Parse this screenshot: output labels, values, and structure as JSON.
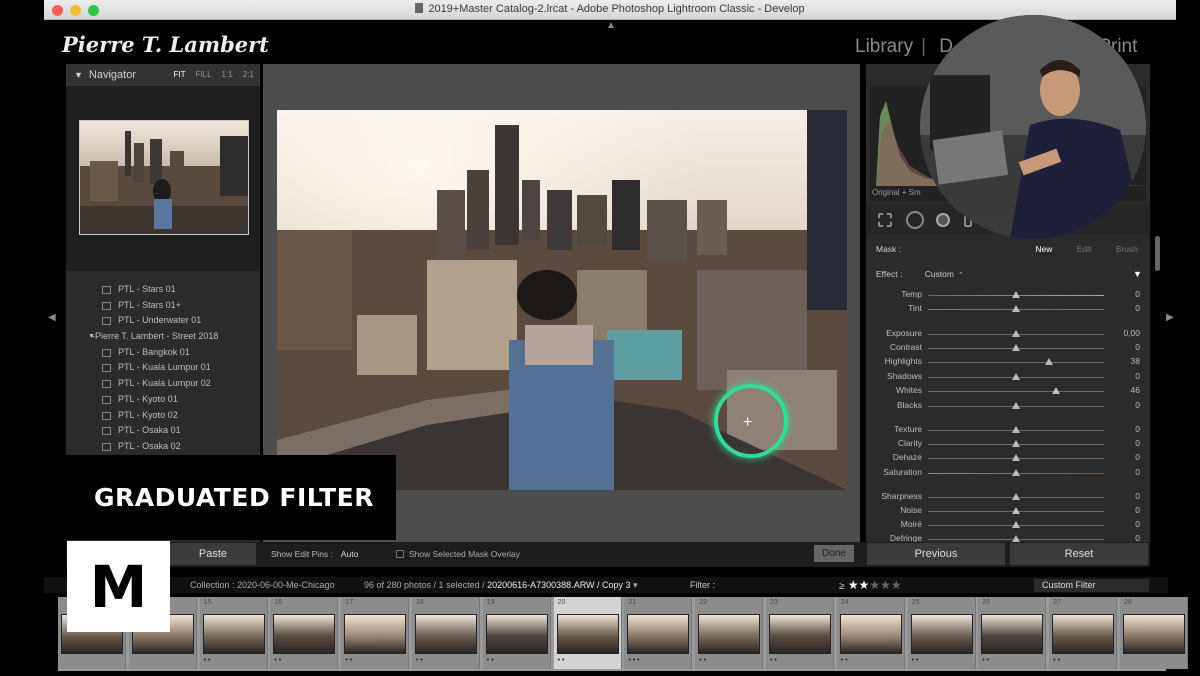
{
  "window": {
    "title": "2019+Master Catalog-2.lrcat - Adobe Photoshop Lightroom Classic - Develop"
  },
  "identity_plate": "Pierre T. Lambert",
  "modules": {
    "library": "Library",
    "develop_partial": "D",
    "print": "Print",
    "separator": "|"
  },
  "navigator": {
    "title": "Navigator",
    "zoom": [
      "FIT",
      "FILL",
      "1:1",
      "2:1"
    ]
  },
  "presets": [
    {
      "label": "PTL - Stars 01",
      "type": "preset"
    },
    {
      "label": "PTL - Stars 01+",
      "type": "preset"
    },
    {
      "label": "PTL - Underwater 01",
      "type": "preset"
    },
    {
      "label": "-Pierre T. Lambert - Street 2018",
      "type": "folder"
    },
    {
      "label": "PTL - Bangkok 01",
      "type": "preset"
    },
    {
      "label": "PTL - Kuala Lumpur 01",
      "type": "preset"
    },
    {
      "label": "PTL - Kuala Lumpur 02",
      "type": "preset"
    },
    {
      "label": "PTL - Kyoto 01",
      "type": "preset"
    },
    {
      "label": "PTL - Kyoto 02",
      "type": "preset"
    },
    {
      "label": "PTL - Osaka 01",
      "type": "preset"
    },
    {
      "label": "PTL - Osaka 02",
      "type": "preset"
    }
  ],
  "histogram": {
    "label": "Original + Sm"
  },
  "mask": {
    "label": "Mask :",
    "new": "New",
    "edit": "Edit",
    "brush": "Brush"
  },
  "effect": {
    "label": "Effect :",
    "value": "Custom"
  },
  "sliders": [
    {
      "label": "Temp",
      "value": "0",
      "pos": 0.5,
      "track": "temp"
    },
    {
      "label": "Tint",
      "value": "0",
      "pos": 0.5,
      "track": "tint"
    },
    {
      "label": "Exposure",
      "value": "0,00",
      "pos": 0.5,
      "track": ""
    },
    {
      "label": "Contrast",
      "value": "0",
      "pos": 0.5,
      "track": ""
    },
    {
      "label": "Highlights",
      "value": "38",
      "pos": 0.69,
      "track": ""
    },
    {
      "label": "Shadows",
      "value": "0",
      "pos": 0.5,
      "track": ""
    },
    {
      "label": "Whites",
      "value": "46",
      "pos": 0.73,
      "track": ""
    },
    {
      "label": "Blacks",
      "value": "0",
      "pos": 0.5,
      "track": ""
    },
    {
      "label": "Texture",
      "value": "0",
      "pos": 0.5,
      "track": ""
    },
    {
      "label": "Clarity",
      "value": "0",
      "pos": 0.5,
      "track": ""
    },
    {
      "label": "Dehaze",
      "value": "0",
      "pos": 0.5,
      "track": ""
    },
    {
      "label": "Saturation",
      "value": "0",
      "pos": 0.5,
      "track": "sat"
    },
    {
      "label": "Sharpness",
      "value": "0",
      "pos": 0.5,
      "track": ""
    },
    {
      "label": "Noise",
      "value": "0",
      "pos": 0.5,
      "track": ""
    },
    {
      "label": "Moiré",
      "value": "0",
      "pos": 0.5,
      "track": ""
    },
    {
      "label": "Defringe",
      "value": "0",
      "pos": 0.5,
      "track": ""
    }
  ],
  "toolbar": {
    "paste": "Paste",
    "show_edit_pins": "Show Edit Pins :",
    "pins_value": "Auto",
    "mask_overlay": "Show Selected Mask Overlay",
    "done": "Done",
    "previous": "Previous",
    "reset": "Reset"
  },
  "filmstrip_bar": {
    "collection": "Collection : 2020-06-00-Me-Chicago",
    "count": "96 of 280 photos / 1 selected /",
    "filename": "20200616-A7300388.ARW / Copy 3",
    "filter_label": "Filter :",
    "rating_filter_prefix": "≥",
    "rating_min": 2,
    "custom_filter": "Custom Filter"
  },
  "filmstrip": [
    {
      "idx": "",
      "dots": "",
      "selected": false
    },
    {
      "idx": "",
      "dots": "",
      "selected": false
    },
    {
      "idx": "15",
      "dots": "• •",
      "selected": false
    },
    {
      "idx": "16",
      "dots": "• •",
      "selected": false
    },
    {
      "idx": "17",
      "dots": "• •",
      "selected": false
    },
    {
      "idx": "18",
      "dots": "• •",
      "selected": false
    },
    {
      "idx": "19",
      "dots": "• •",
      "selected": false
    },
    {
      "idx": "20",
      "dots": "• •",
      "selected": true
    },
    {
      "idx": "21",
      "dots": "• • •",
      "selected": false
    },
    {
      "idx": "22",
      "dots": "• •",
      "selected": false
    },
    {
      "idx": "23",
      "dots": "• •",
      "selected": false
    },
    {
      "idx": "24",
      "dots": "• •",
      "selected": false
    },
    {
      "idx": "25",
      "dots": "• •",
      "selected": false
    },
    {
      "idx": "26",
      "dots": "• •",
      "selected": false
    },
    {
      "idx": "27",
      "dots": "• •",
      "selected": false
    },
    {
      "idx": "28",
      "dots": "",
      "selected": false
    }
  ],
  "overlay": {
    "caption": "GRADUATED FILTER",
    "logo": "M"
  },
  "colors": {
    "mask_ring": "#2ce09a",
    "panel": "#2b2b2b",
    "center": "#4d4d4d"
  }
}
